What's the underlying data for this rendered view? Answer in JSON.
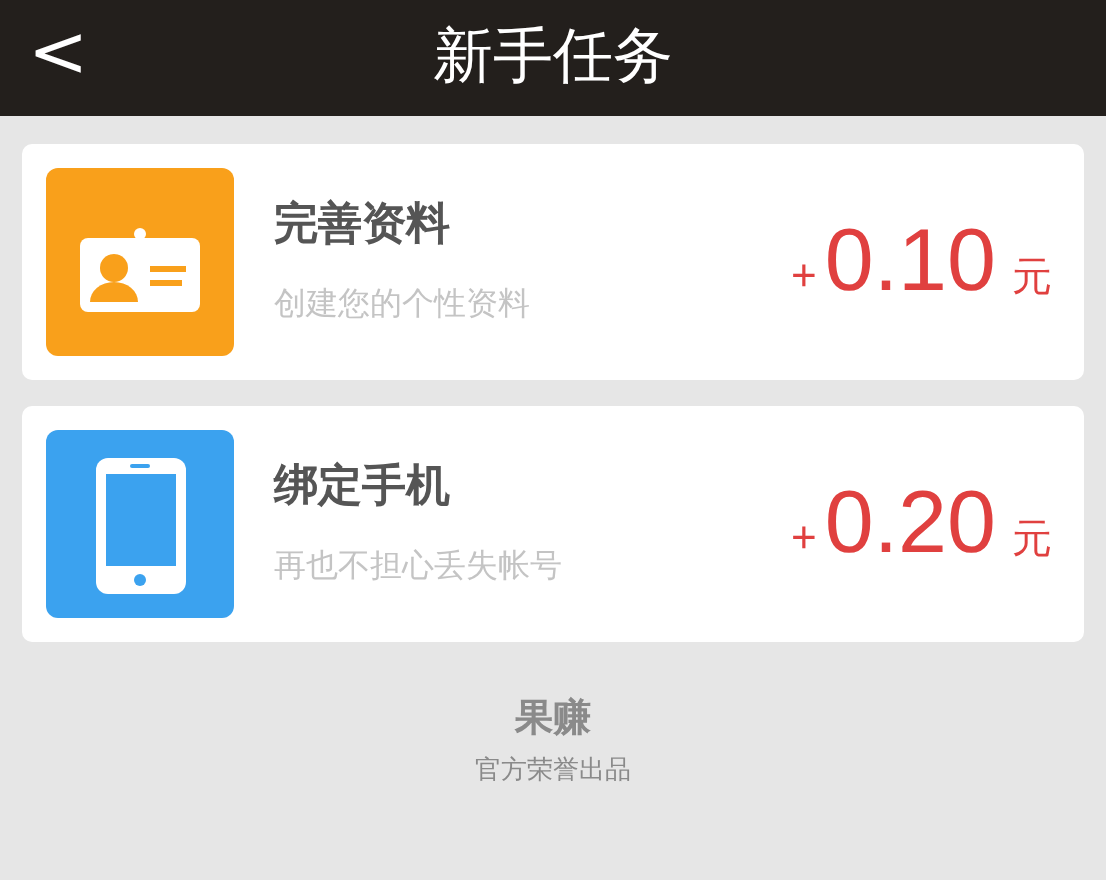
{
  "header": {
    "back": "<",
    "title": "新手任务"
  },
  "tasks": [
    {
      "kind": "profile",
      "color": "#f9a01b",
      "title": "完善资料",
      "subtitle": "创建您的个性资料",
      "sign": "+",
      "amount": "0.10",
      "unit": "元"
    },
    {
      "kind": "phone",
      "color": "#3ba2ef",
      "title": "绑定手机",
      "subtitle": "再也不担心丢失帐号",
      "sign": "+",
      "amount": "0.20",
      "unit": "元"
    }
  ],
  "footer": {
    "brand": "果赚",
    "tagline": "官方荣誉出品"
  }
}
